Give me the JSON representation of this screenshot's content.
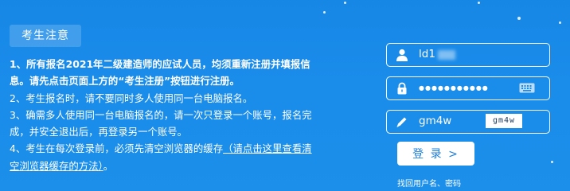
{
  "notice": {
    "title": "考生注意",
    "items": [
      {
        "text": "1、所有报名2021年二级建造师的应试人员，均须重新注册并填报信息。请先点击页面上方的“考生注册”按钮进行注册。"
      },
      {
        "text": "2、考生报名时，请不要同时多人使用同一台电脑报名。"
      },
      {
        "text": "3、确需多人使用同一台电脑报名的，请一次只登录一个账号，报名完成，并安全退出后，再登录另一个账号。"
      },
      {
        "text_before": "4、考生在每次登录前，必须先清空浏览器的缓存",
        "link": "（请点击这里查看清空浏览器缓存的方法）",
        "text_after": "。"
      }
    ]
  },
  "login": {
    "username_value": "ld1",
    "password_mask": "●●●●●●●●●●●",
    "captcha_input_value": "gm4w",
    "captcha_image_text": "gm4w",
    "submit_label": "登 录 >",
    "forgot_label": "找回用户名、密码"
  },
  "icons": {
    "username": "user-icon",
    "password": "lock-icon",
    "keyboard": "keyboard-icon",
    "captcha": "pen-icon"
  },
  "colors": {
    "background": "#1a8ae8",
    "button_text": "#1b7fdc"
  }
}
